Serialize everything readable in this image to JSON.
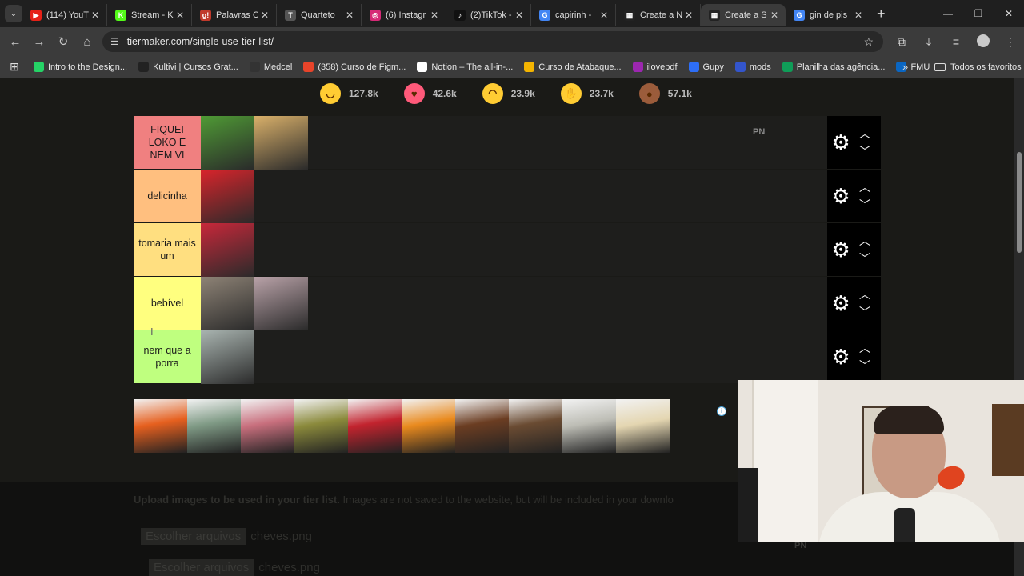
{
  "browser": {
    "tabs": [
      {
        "title": "(114) YouT",
        "favicon_color": "#e62117",
        "favicon_glyph": "▶",
        "active": false
      },
      {
        "title": "Stream - K",
        "favicon_color": "#53fc18",
        "favicon_glyph": "K",
        "active": false
      },
      {
        "title": "Palavras C",
        "favicon_color": "#c0392b",
        "favicon_glyph": "g!",
        "active": false
      },
      {
        "title": "Quarteto",
        "favicon_color": "#555555",
        "favicon_glyph": "T",
        "active": false
      },
      {
        "title": "(6) Instagr",
        "favicon_color": "#d62976",
        "favicon_glyph": "◎",
        "active": false
      },
      {
        "title": "(2)TikTok -",
        "favicon_color": "#111111",
        "favicon_glyph": "♪",
        "active": false
      },
      {
        "title": "capirinh -",
        "favicon_color": "#4285f4",
        "favicon_glyph": "G",
        "active": false
      },
      {
        "title": "Create a N",
        "favicon_color": "#222222",
        "favicon_glyph": "▦",
        "active": false
      },
      {
        "title": "Create a S",
        "favicon_color": "#222222",
        "favicon_glyph": "▦",
        "active": true
      },
      {
        "title": "gin de pis",
        "favicon_color": "#4285f4",
        "favicon_glyph": "G",
        "active": false
      }
    ],
    "url": "tiermaker.com/single-use-tier-list/",
    "bookmarks": [
      {
        "label": "Intro to the Design...",
        "color": "#25d366"
      },
      {
        "label": "Kultivi | Cursos Grat...",
        "color": "#222222"
      },
      {
        "label": "Medcel",
        "color": "#333333"
      },
      {
        "label": "(358) Curso de Figm...",
        "color": "#e8442a"
      },
      {
        "label": "Notion – The all-in-...",
        "color": "#ffffff"
      },
      {
        "label": "Curso de Atabaque...",
        "color": "#f4b400"
      },
      {
        "label": "ilovepdf",
        "color": "#9c27b0"
      },
      {
        "label": "Gupy",
        "color": "#2d6ef7"
      },
      {
        "label": "mods",
        "color": "#3355cc"
      },
      {
        "label": "Planilha das agência...",
        "color": "#0f9d58"
      },
      {
        "label": "FMU",
        "color": "#0a66c2"
      }
    ],
    "all_bookmarks_label": "Todos os favoritos"
  },
  "reactions": [
    {
      "icon": "grin-emoji-icon",
      "count": "127.8k",
      "color": "#ffcc33"
    },
    {
      "icon": "heart-eyes-emoji-icon",
      "count": "42.6k",
      "color": "#ff5a7a"
    },
    {
      "icon": "laugh-emoji-icon",
      "count": "23.9k",
      "color": "#ffcc33"
    },
    {
      "icon": "raised-hands-emoji-icon",
      "count": "23.7k",
      "color": "#ffcc33"
    },
    {
      "icon": "poop-emoji-icon",
      "count": "57.1k",
      "color": "#9b5c3b"
    }
  ],
  "tiers": [
    {
      "label": "FIQUEI LOKO E NEM VI",
      "color": "#f08080",
      "items": [
        "#4f9a35",
        "#d9b06a"
      ],
      "note": "PN"
    },
    {
      "label": "delicinha",
      "color": "#ffbf7f",
      "items": [
        "#d9242b"
      ],
      "note": ""
    },
    {
      "label": "tomaria mais um",
      "color": "#ffdf80",
      "items": [
        "#c8283a"
      ],
      "note": ""
    },
    {
      "label": "bebível",
      "color": "#ffff7f",
      "items": [
        "#8e8376",
        "#b9a2a8"
      ],
      "note": ""
    },
    {
      "label": "nem que a porra",
      "color": "#bfff7f",
      "items": [
        "#a9b4b0"
      ],
      "note": ""
    }
  ],
  "pool_items": [
    "#e6601f",
    "#7f9a85",
    "#c86f7d",
    "#8b8a3c",
    "#c2232e",
    "#e98a1e",
    "#6b3d22",
    "#6a4b32",
    "#bdbdb5",
    "#e4d6b1"
  ],
  "upload": {
    "text_bold": "Upload images to be used in your tier list.",
    "text_rest": " Images are not saved to the website, but will be included in your downlo",
    "file_button": "Escolher arquivos",
    "file_name": "cheves.png"
  },
  "overlay_note": "PN"
}
